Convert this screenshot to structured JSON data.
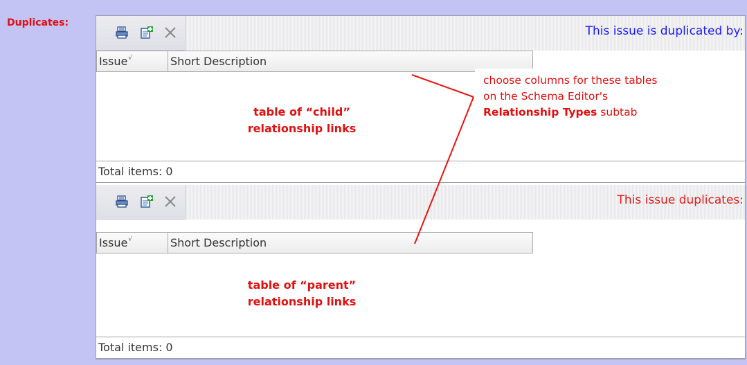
{
  "field_label": "Duplicates:",
  "child_section": {
    "caption": "This issue is duplicated by:",
    "columns": [
      "Issue",
      "Short Description"
    ],
    "note_line1": "table of “child”",
    "note_line2": "relationship  links",
    "footer": "Total items: 0"
  },
  "parent_section": {
    "caption": "This issue duplicates:",
    "columns": [
      "Issue",
      "Short Description"
    ],
    "note_line1": "table of “parent”",
    "note_line2": "relationship  links",
    "footer": "Total items: 0"
  },
  "toolbar_icons": [
    "link-records-icon",
    "add-record-icon",
    "remove-icon"
  ],
  "callout": {
    "line1": "choose columns for these tables",
    "line2": "on the Schema Editor's",
    "bold_part": "Relationship Types",
    "line3_rest": " subtab"
  },
  "colors": {
    "background": "#c4c4f4",
    "label_red": "#e01010",
    "caption_blue": "#1a1aff",
    "caption_red": "#e01c1c"
  }
}
